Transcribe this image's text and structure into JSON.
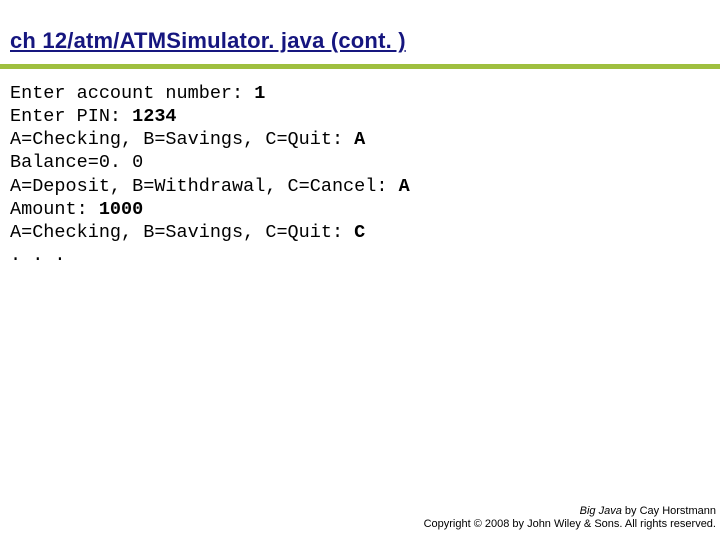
{
  "header": {
    "title": "ch 12/atm/ATMSimulator. java  (cont. )"
  },
  "code": {
    "l1a": "Enter account number: ",
    "l1b": "1",
    "l2a": "Enter PIN: ",
    "l2b": "1234",
    "l3a": "A=Checking, B=Savings, C=Quit: ",
    "l3b": "A",
    "l4": "Balance=0. 0",
    "l5a": "A=Deposit, B=Withdrawal, C=Cancel: ",
    "l5b": "A",
    "l6a": "Amount: ",
    "l6b": "1000",
    "l7a": "A=Checking, B=Savings, C=Quit: ",
    "l7b": "C",
    "l8": ". . ."
  },
  "footer": {
    "book": "Big Java",
    "byline": " by Cay Horstmann",
    "copyright": "Copyright © 2008 by John Wiley & Sons.  All rights reserved."
  }
}
